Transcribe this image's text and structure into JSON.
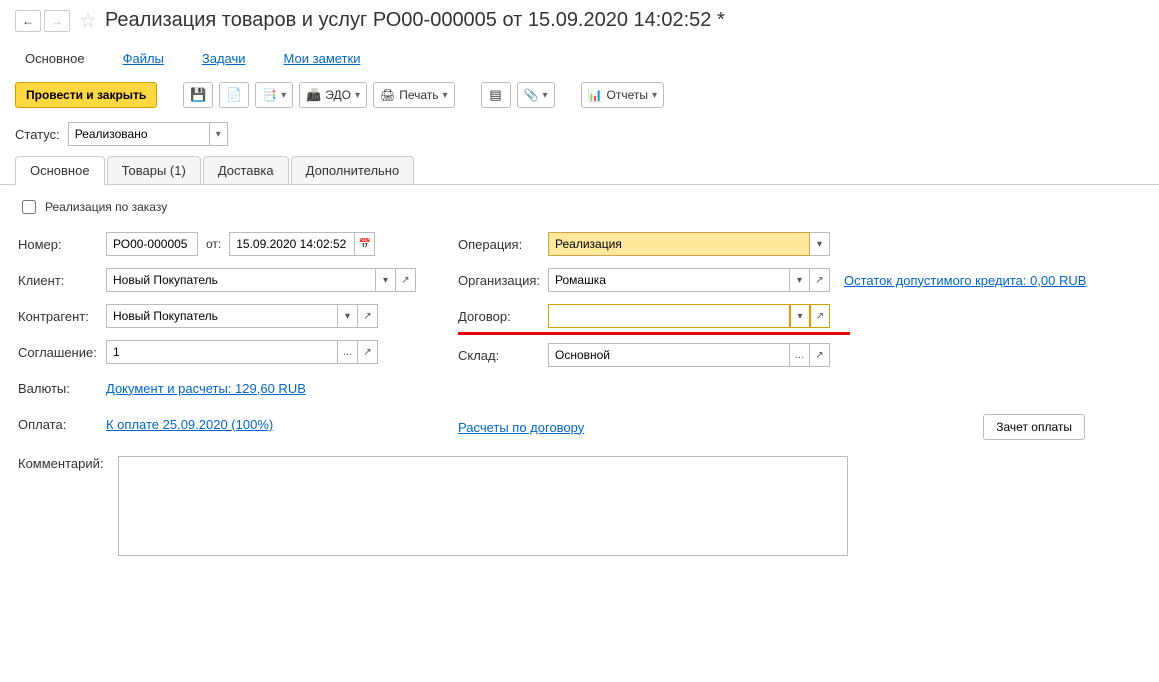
{
  "header": {
    "title": "Реализация товаров и услуг РО00-000005 от 15.09.2020 14:02:52 *"
  },
  "nav": {
    "main": "Основное",
    "files": "Файлы",
    "tasks": "Задачи",
    "notes": "Мои заметки"
  },
  "toolbar": {
    "post_close": "Провести и закрыть",
    "edo": "ЭДО",
    "print": "Печать",
    "reports": "Отчеты"
  },
  "status": {
    "label": "Статус:",
    "value": "Реализовано"
  },
  "tabs": {
    "main": "Основное",
    "goods": "Товары (1)",
    "delivery": "Доставка",
    "extra": "Дополнительно"
  },
  "form": {
    "by_order": "Реализация по заказу",
    "number_lbl": "Номер:",
    "number": "РО00-000005",
    "from_lbl": "от:",
    "date": "15.09.2020 14:02:52",
    "client_lbl": "Клиент:",
    "client": "Новый Покупатель",
    "contragent_lbl": "Контрагент:",
    "contragent": "Новый Покупатель",
    "agreement_lbl": "Соглашение:",
    "agreement": "1",
    "currency_lbl": "Валюты:",
    "currency_link": "Документ и расчеты: 129,60 RUB",
    "payment_lbl": "Оплата:",
    "payment_link": "К оплате 25.09.2020 (100%)",
    "settle_link": "Расчеты по договору",
    "comment_lbl": "Комментарий:",
    "comment": "",
    "operation_lbl": "Операция:",
    "operation": "Реализация",
    "org_lbl": "Организация:",
    "org": "Ромашка",
    "credit_link": "Остаток допустимого кредита: 0,00 RUB",
    "contract_lbl": "Договор:",
    "contract": "",
    "warehouse_lbl": "Склад:",
    "warehouse": "Основной",
    "offset_btn": "Зачет оплаты"
  }
}
